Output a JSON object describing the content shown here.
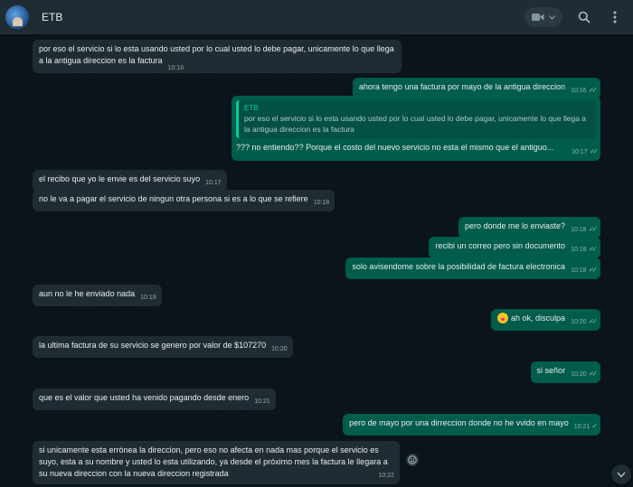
{
  "header": {
    "contact_name": "ETB"
  },
  "messages": [
    {
      "dir": "in",
      "text": "por eso el servicio si lo esta usando usted por lo cual usted lo debe pagar, unicamente lo que llega a la antigua direccion es la factura",
      "time": "10:16"
    },
    {
      "dir": "out",
      "text": "ahora tengo una factura por mayo de la antigua direccion",
      "time": "10:16"
    },
    {
      "dir": "out",
      "quote_author": "ETB",
      "quote_text": "por eso el servicio si lo esta usando usted por lo cual usted lo debe pagar, unicamente lo que llega a la antigua direccion es la factura",
      "text": "??? no entiendo?? Porque el costo del nuevo servicio no esta el mismo que el antiguo...",
      "time": "10:17"
    },
    {
      "dir": "in",
      "text": "el recibo que yo le envie es del servicio suyo",
      "time": "10:17"
    },
    {
      "dir": "in",
      "text": "no le va a pagar el servicio de ningun otra persona si es a lo que se refiere",
      "time": "10:18"
    },
    {
      "dir": "out",
      "text": "pero donde me lo enviaste?",
      "time": "10:18"
    },
    {
      "dir": "out",
      "text": "recibi un correo pero sin documento",
      "time": "10:18"
    },
    {
      "dir": "out",
      "text": "solo avisendome sobre la posibilidad de factura electronica",
      "time": "10:18"
    },
    {
      "dir": "in",
      "text": "aun no le he enviado nada",
      "time": "10:19"
    },
    {
      "dir": "out",
      "text": "ah ok, disculpa",
      "time": "10:20",
      "emoji": "face-with-tongue-emoji"
    },
    {
      "dir": "in",
      "text": "la ultima factura de su servicio se genero por valor de $107270",
      "time": "10:20"
    },
    {
      "dir": "out",
      "text": "si señor",
      "time": "10:20"
    },
    {
      "dir": "in",
      "text": "que es el valor que usted ha venido pagando desde enero",
      "time": "10:21"
    },
    {
      "dir": "out",
      "text": "pero de mayo por una dirreccion donde no he vvido en mayo",
      "time": "10:21"
    },
    {
      "dir": "in",
      "text": "si unicamente esta errónea la direccion, pero eso no afecta en nada mas porque el servicio es suyo, esta a su nombre y usted lo esta utilizando, ya desde el próximo mes la factura le llegara a su nueva direccion con la nueva direccion registrada",
      "time": "10:22"
    }
  ],
  "icons": {
    "video_call": "video-camera-icon",
    "search": "search-icon",
    "menu": "kebab-menu-icon",
    "scroll_down": "chevron-down-icon",
    "react": "smiley-icon"
  },
  "colors": {
    "background": "#0b141a",
    "header": "#202c33",
    "incoming_bubble": "#202c33",
    "outgoing_bubble": "#005c4b",
    "quote_accent": "#06cf9c",
    "read_ticks": "#8fb9ad"
  }
}
